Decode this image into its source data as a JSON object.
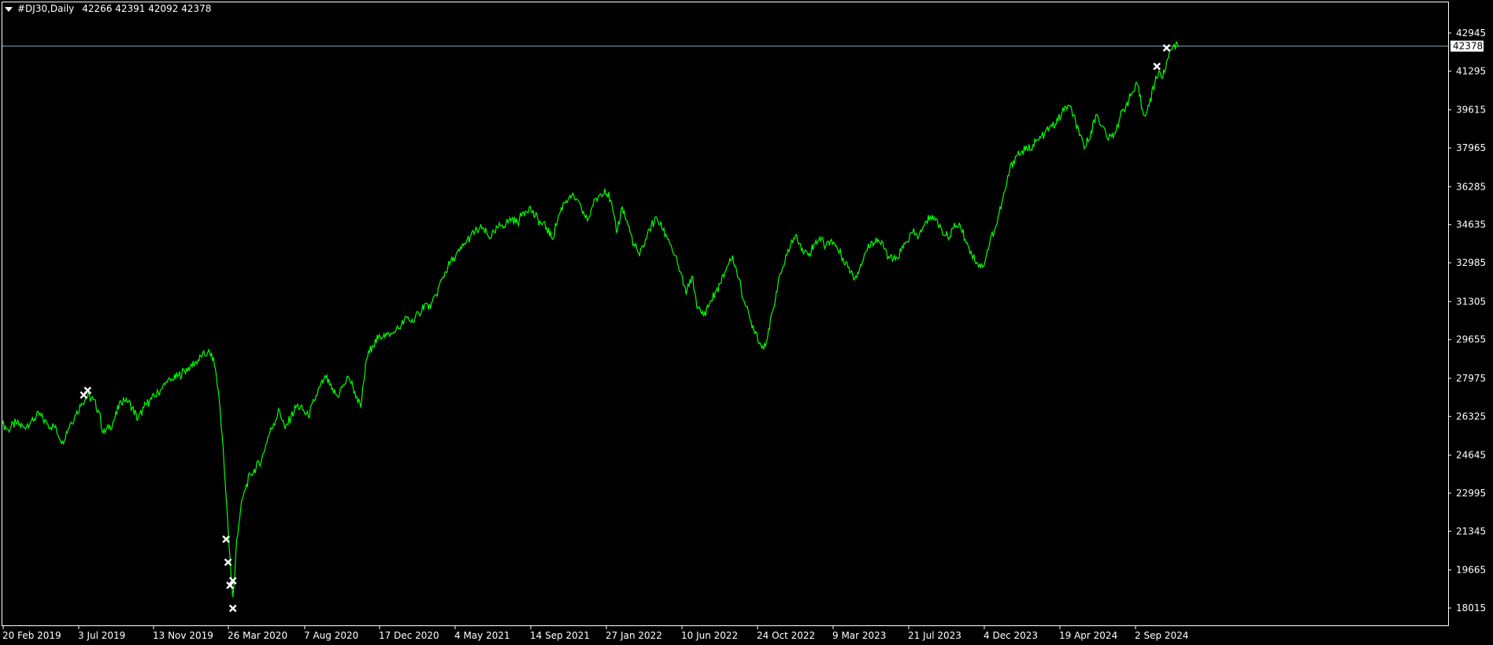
{
  "header": {
    "symbol": "#DJ30,Daily",
    "ohlc": "42266 42391 42092 42378"
  },
  "colors": {
    "background": "#000000",
    "price_line": "#00ff00",
    "axis": "#ffffff",
    "current_price_line": "#8fa8b8",
    "marker": "#ffffff"
  },
  "current_price": {
    "value": 42378,
    "label": "42378"
  },
  "chart_data": {
    "type": "line",
    "y_ticks": [
      "42945",
      "41295",
      "39615",
      "37965",
      "36285",
      "34635",
      "32985",
      "31305",
      "29655",
      "27975",
      "26325",
      "24645",
      "22995",
      "21345",
      "19665",
      "18015"
    ],
    "x_ticks": [
      "20 Feb 2019",
      "3 Jul 2019",
      "13 Nov 2019",
      "26 Mar 2020",
      "7 Aug 2020",
      "17 Dec 2020",
      "4 May 2021",
      "14 Sep 2021",
      "27 Jan 2022",
      "10 Jun 2022",
      "24 Oct 2022",
      "9 Mar 2023",
      "21 Jul 2023",
      "4 Dec 2023",
      "19 Apr 2024",
      "2 Sep 2024"
    ],
    "ylim": [
      17700,
      43500
    ],
    "series": [
      {
        "values": [
          [
            0,
            26000
          ],
          [
            6,
            25750
          ],
          [
            14,
            26050
          ],
          [
            22,
            25850
          ],
          [
            30,
            26150
          ],
          [
            38,
            26400
          ],
          [
            46,
            26000
          ],
          [
            54,
            25850
          ],
          [
            62,
            25250
          ],
          [
            70,
            26000
          ],
          [
            76,
            26400
          ],
          [
            82,
            26900
          ],
          [
            88,
            27200
          ],
          [
            94,
            27050
          ],
          [
            100,
            26500
          ],
          [
            104,
            25600
          ],
          [
            110,
            25800
          ],
          [
            116,
            26200
          ],
          [
            122,
            27000
          ],
          [
            128,
            27100
          ],
          [
            134,
            26700
          ],
          [
            140,
            26200
          ],
          [
            146,
            26700
          ],
          [
            152,
            27000
          ],
          [
            158,
            27200
          ],
          [
            164,
            27500
          ],
          [
            170,
            27800
          ],
          [
            176,
            27900
          ],
          [
            182,
            28100
          ],
          [
            188,
            28300
          ],
          [
            194,
            28500
          ],
          [
            200,
            28700
          ],
          [
            206,
            28900
          ],
          [
            212,
            29100
          ],
          [
            216,
            29050
          ],
          [
            220,
            28400
          ],
          [
            224,
            27000
          ],
          [
            227,
            25500
          ],
          [
            230,
            23500
          ],
          [
            233,
            21500
          ],
          [
            236,
            19500
          ],
          [
            238,
            18500
          ],
          [
            240,
            19500
          ],
          [
            242,
            21000
          ],
          [
            246,
            22300
          ],
          [
            250,
            23100
          ],
          [
            256,
            23800
          ],
          [
            262,
            24100
          ],
          [
            268,
            24500
          ],
          [
            274,
            25400
          ],
          [
            280,
            26000
          ],
          [
            286,
            26600
          ],
          [
            292,
            25800
          ],
          [
            298,
            26300
          ],
          [
            304,
            26800
          ],
          [
            310,
            26600
          ],
          [
            316,
            26300
          ],
          [
            322,
            27000
          ],
          [
            328,
            27600
          ],
          [
            334,
            28000
          ],
          [
            340,
            27500
          ],
          [
            346,
            27200
          ],
          [
            352,
            27700
          ],
          [
            358,
            28000
          ],
          [
            364,
            27400
          ],
          [
            370,
            26700
          ],
          [
            376,
            28800
          ],
          [
            382,
            29400
          ],
          [
            388,
            29700
          ],
          [
            394,
            29900
          ],
          [
            400,
            29800
          ],
          [
            406,
            30000
          ],
          [
            412,
            30300
          ],
          [
            418,
            30600
          ],
          [
            424,
            30400
          ],
          [
            430,
            30800
          ],
          [
            436,
            31200
          ],
          [
            442,
            31000
          ],
          [
            448,
            31600
          ],
          [
            454,
            32300
          ],
          [
            460,
            32800
          ],
          [
            466,
            33200
          ],
          [
            472,
            33500
          ],
          [
            478,
            33800
          ],
          [
            484,
            34200
          ],
          [
            490,
            34400
          ],
          [
            496,
            34500
          ],
          [
            502,
            34100
          ],
          [
            508,
            34300
          ],
          [
            514,
            34600
          ],
          [
            520,
            34700
          ],
          [
            526,
            34900
          ],
          [
            532,
            34700
          ],
          [
            538,
            35200
          ],
          [
            544,
            35400
          ],
          [
            550,
            35000
          ],
          [
            556,
            34700
          ],
          [
            562,
            34500
          ],
          [
            568,
            34000
          ],
          [
            574,
            35000
          ],
          [
            580,
            35600
          ],
          [
            586,
            35900
          ],
          [
            592,
            35700
          ],
          [
            598,
            35300
          ],
          [
            604,
            34800
          ],
          [
            610,
            35500
          ],
          [
            616,
            35900
          ],
          [
            622,
            36200
          ],
          [
            628,
            35700
          ],
          [
            634,
            34300
          ],
          [
            640,
            35400
          ],
          [
            646,
            34600
          ],
          [
            652,
            33800
          ],
          [
            658,
            33300
          ],
          [
            664,
            34000
          ],
          [
            670,
            34600
          ],
          [
            676,
            34900
          ],
          [
            682,
            34400
          ],
          [
            688,
            34000
          ],
          [
            694,
            33300
          ],
          [
            700,
            32600
          ],
          [
            706,
            31600
          ],
          [
            712,
            32400
          ],
          [
            718,
            31000
          ],
          [
            724,
            30700
          ],
          [
            730,
            31200
          ],
          [
            736,
            31700
          ],
          [
            742,
            32100
          ],
          [
            748,
            32800
          ],
          [
            754,
            33300
          ],
          [
            760,
            32300
          ],
          [
            766,
            31300
          ],
          [
            772,
            30500
          ],
          [
            778,
            30000
          ],
          [
            784,
            29300
          ],
          [
            790,
            29700
          ],
          [
            796,
            31000
          ],
          [
            802,
            32400
          ],
          [
            808,
            33000
          ],
          [
            814,
            33800
          ],
          [
            820,
            34200
          ],
          [
            826,
            33600
          ],
          [
            832,
            33300
          ],
          [
            838,
            33800
          ],
          [
            844,
            34100
          ],
          [
            850,
            33700
          ],
          [
            856,
            34000
          ],
          [
            862,
            33600
          ],
          [
            868,
            33200
          ],
          [
            874,
            32800
          ],
          [
            880,
            32300
          ],
          [
            886,
            32900
          ],
          [
            892,
            33500
          ],
          [
            898,
            33900
          ],
          [
            904,
            34000
          ],
          [
            910,
            33600
          ],
          [
            916,
            33200
          ],
          [
            922,
            33100
          ],
          [
            928,
            33500
          ],
          [
            934,
            33900
          ],
          [
            940,
            34300
          ],
          [
            946,
            34100
          ],
          [
            952,
            34600
          ],
          [
            958,
            35000
          ],
          [
            964,
            34900
          ],
          [
            970,
            34400
          ],
          [
            976,
            34100
          ],
          [
            982,
            34500
          ],
          [
            988,
            34700
          ],
          [
            994,
            34000
          ],
          [
            1000,
            33500
          ],
          [
            1006,
            33000
          ],
          [
            1012,
            32800
          ],
          [
            1016,
            33300
          ],
          [
            1020,
            34000
          ],
          [
            1026,
            34600
          ],
          [
            1032,
            35600
          ],
          [
            1036,
            36200
          ],
          [
            1040,
            37000
          ],
          [
            1046,
            37600
          ],
          [
            1052,
            37800
          ],
          [
            1058,
            37900
          ],
          [
            1064,
            38100
          ],
          [
            1070,
            38300
          ],
          [
            1076,
            38600
          ],
          [
            1082,
            38900
          ],
          [
            1088,
            39000
          ],
          [
            1094,
            39500
          ],
          [
            1100,
            39800
          ],
          [
            1106,
            39400
          ],
          [
            1112,
            38500
          ],
          [
            1118,
            38000
          ],
          [
            1124,
            38700
          ],
          [
            1130,
            39400
          ],
          [
            1136,
            38900
          ],
          [
            1142,
            38300
          ],
          [
            1148,
            38600
          ],
          [
            1154,
            39300
          ],
          [
            1160,
            39800
          ],
          [
            1166,
            40300
          ],
          [
            1172,
            40700
          ],
          [
            1178,
            39400
          ],
          [
            1184,
            39800
          ],
          [
            1190,
            40800
          ],
          [
            1194,
            41300
          ],
          [
            1198,
            41000
          ],
          [
            1202,
            41700
          ],
          [
            1206,
            42200
          ],
          [
            1210,
            42450
          ],
          [
            1214,
            42350
          ]
        ]
      }
    ],
    "markers": [
      [
        84,
        27250
      ],
      [
        88,
        27450
      ],
      [
        231,
        21000
      ],
      [
        233,
        20000
      ],
      [
        235,
        19000
      ],
      [
        238,
        19200
      ],
      [
        238,
        18000
      ],
      [
        1192,
        41500
      ],
      [
        1202,
        42300
      ]
    ]
  }
}
